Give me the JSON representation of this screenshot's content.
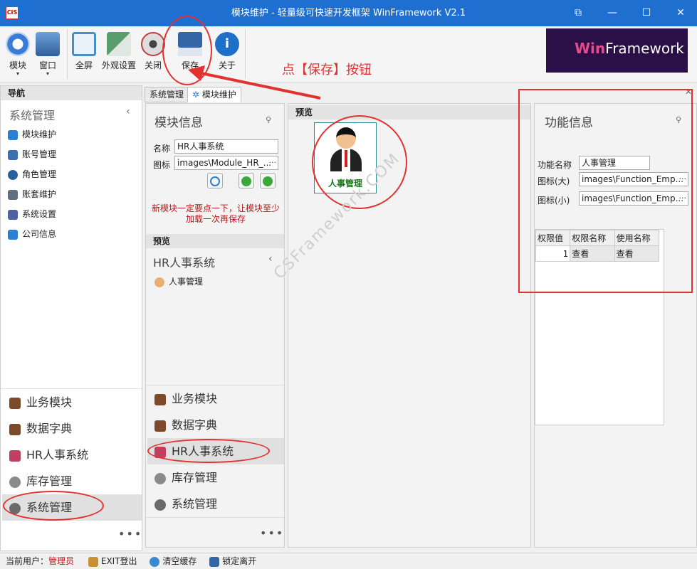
{
  "window": {
    "title": "模块维护 - 轻量级可快速开发框架 WinFramework V2.1",
    "logo": "CIS"
  },
  "ribbon": {
    "buttons": [
      {
        "label": "模块",
        "icon": "compass-icon",
        "color": "#3a7bd5"
      },
      {
        "label": "窗口",
        "icon": "eye-window-icon",
        "color": "#4a7db8"
      },
      {
        "label": "全屏",
        "icon": "fullscreen-icon",
        "color": "#4a90c8"
      },
      {
        "label": "外观设置",
        "icon": "appearance-icon",
        "color": "#5a9e6f"
      },
      {
        "label": "关闭",
        "icon": "close-eye-icon",
        "color": "#c04040"
      },
      {
        "label": "保存",
        "icon": "floppy-save-icon",
        "color": "#3465a4"
      },
      {
        "label": "关于",
        "icon": "info-icon",
        "color": "#1e6fc7"
      }
    ],
    "brand": {
      "win": "Win",
      "rest": "Framework"
    }
  },
  "annotation": {
    "text": "点【保存】按钮"
  },
  "nav": {
    "header": "导航",
    "group_title": "系统管理",
    "items": [
      {
        "label": "模块维护",
        "icon": "gear-module-icon",
        "color": "#2a7fd0"
      },
      {
        "label": "账号管理",
        "icon": "users-icon",
        "color": "#3a6fb0"
      },
      {
        "label": "角色管理",
        "icon": "role-icon",
        "color": "#2a5fa0"
      },
      {
        "label": "账套维护",
        "icon": "database-icon",
        "color": "#607080"
      },
      {
        "label": "系统设置",
        "icon": "settings-icon",
        "color": "#5060a0"
      },
      {
        "label": "公司信息",
        "icon": "home-icon",
        "color": "#2a7fd0"
      }
    ],
    "bottom_items": [
      {
        "label": "业务模块",
        "icon": "book-icon",
        "color": "#7a4a2a"
      },
      {
        "label": "数据字典",
        "icon": "book-icon",
        "color": "#7a4a2a"
      },
      {
        "label": "HR人事系统",
        "icon": "hr-icon",
        "color": "#c04060"
      },
      {
        "label": "库存管理",
        "icon": "database-icon",
        "color": "#8a8a8a"
      },
      {
        "label": "系统管理",
        "icon": "gear-icon",
        "color": "#6a6a6a"
      }
    ],
    "more": "•••"
  },
  "tabs": [
    {
      "label": "系统管理"
    },
    {
      "label": "模块维护"
    }
  ],
  "module_panel": {
    "title": "模块信息",
    "name_label": "名称",
    "name_value": "HR人事系统",
    "icon_label": "图标",
    "icon_value": "images\\Module_HR_...",
    "warning_line1": "新模块一定要点一下，让模块至少",
    "warning_line2": "加载一次再保存",
    "preview_header": "预览",
    "preview_title": "HR人事系统",
    "preview_item": "人事管理",
    "bottom_items": [
      {
        "label": "业务模块"
      },
      {
        "label": "数据字典"
      },
      {
        "label": "HR人事系统"
      },
      {
        "label": "库存管理"
      },
      {
        "label": "系统管理"
      }
    ],
    "more": "•••"
  },
  "preview_panel": {
    "header": "预览",
    "tile_label": "人事管理"
  },
  "function_panel": {
    "title": "功能信息",
    "name_label": "功能名称",
    "name_value": "人事管理",
    "icon_large_label": "图标(大)",
    "icon_large_value": "images\\Function_Emp...",
    "icon_small_label": "图标(小)",
    "icon_small_value": "images\\Function_Emp...",
    "grid": {
      "headers": [
        "权限值",
        "权限名称",
        "使用名称"
      ],
      "rows": [
        [
          "1",
          "查看",
          "查看"
        ]
      ]
    }
  },
  "watermark": "CSFramework.COM",
  "status": {
    "user_label": "当前用户：",
    "user_value": "管理员",
    "exit": "EXIT登出",
    "clear_cache": "清空缓存",
    "lock": "锁定离开"
  },
  "colors": {
    "titlebar": "#1f6fd1",
    "annotation": "#e3312f",
    "warning": "#c0141a"
  }
}
